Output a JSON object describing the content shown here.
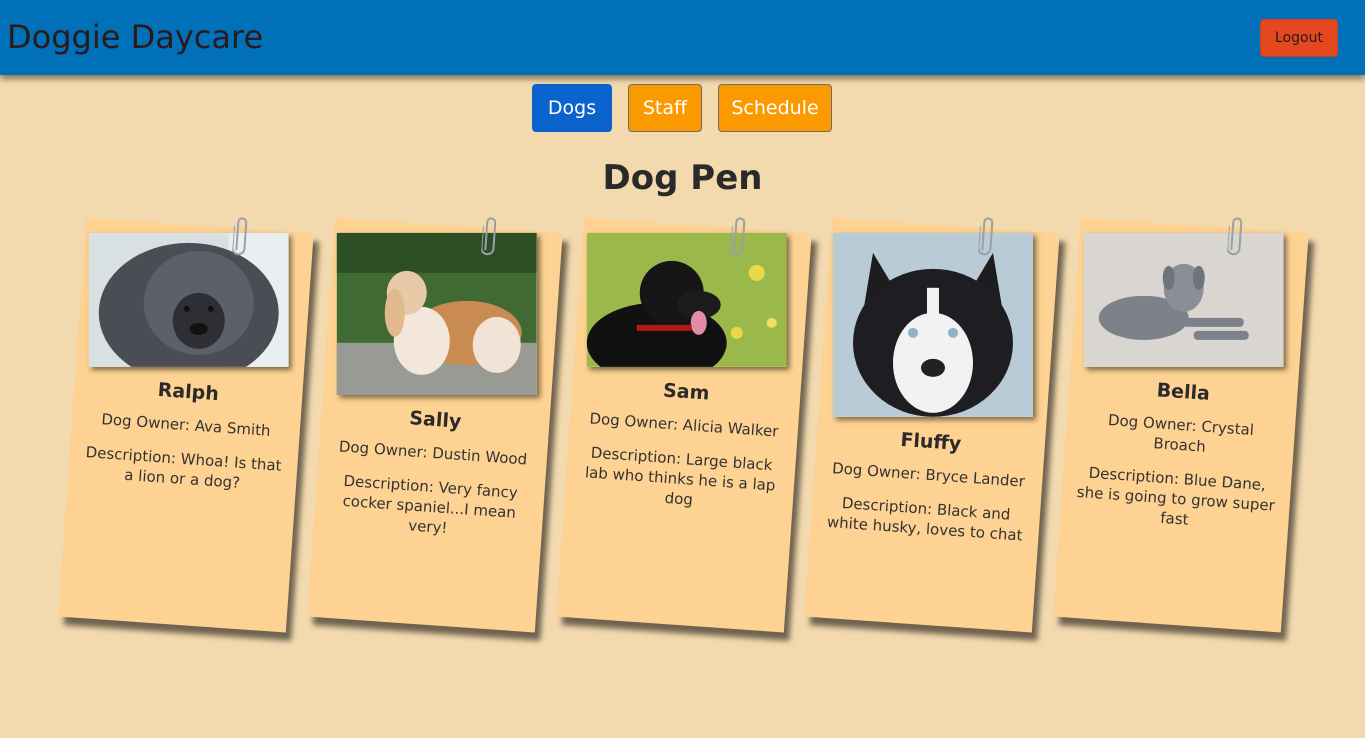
{
  "header": {
    "brand": "Doggie Daycare",
    "logout_label": "Logout"
  },
  "tabs": [
    {
      "label": "Dogs",
      "active": true
    },
    {
      "label": "Staff",
      "active": false
    },
    {
      "label": "Schedule",
      "active": false
    }
  ],
  "page_title": "Dog Pen",
  "colors": {
    "navbar": "#0070b9",
    "background": "#f3d9ae",
    "card": "#fdd292",
    "active_tab": "#0b63ce",
    "inactive_tab": "#fb9a00",
    "logout": "#e5481e"
  },
  "dogs": [
    {
      "name": "Ralph",
      "owner": "Dog Owner: Ava Smith",
      "description": "Description: Whoa! Is that a lion or a dog?",
      "image": "tibetan-mastiff-photo"
    },
    {
      "name": "Sally",
      "owner": "Dog Owner: Dustin Wood",
      "description": "Description: Very fancy cocker spaniel...I mean very!",
      "image": "cocker-spaniel-photo"
    },
    {
      "name": "Sam",
      "owner": "Dog Owner: Alicia Walker",
      "description": "Description: Large black lab who thinks he is a lap dog",
      "image": "black-lab-photo"
    },
    {
      "name": "Fluffy",
      "owner": "Dog Owner: Bryce Lander",
      "description": "Description: Black and white husky, loves to chat",
      "image": "husky-photo"
    },
    {
      "name": "Bella",
      "owner": "Dog Owner: Crystal Broach",
      "description": "Description: Blue Dane, she is going to grow super fast",
      "image": "great-dane-photo"
    }
  ]
}
